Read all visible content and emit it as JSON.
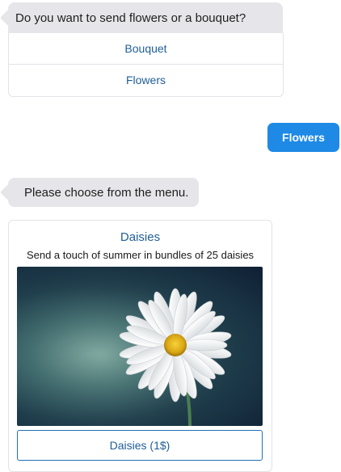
{
  "messages": {
    "bot_question": "Do you want to send flowers or a bouquet?",
    "quick_replies": [
      "Bouquet",
      "Flowers"
    ],
    "user_reply": "Flowers",
    "bot_prompt": "Please choose from the menu."
  },
  "card": {
    "title": "Daisies",
    "subtitle": "Send a touch of summer in bundles of 25 daisies",
    "image_subject": "daisy-flower",
    "button_label": "Daisies (1$)"
  },
  "colors": {
    "bot_bubble": "#e6e6ea",
    "user_bubble": "#1e8ae6",
    "link_blue": "#1f5e96"
  }
}
